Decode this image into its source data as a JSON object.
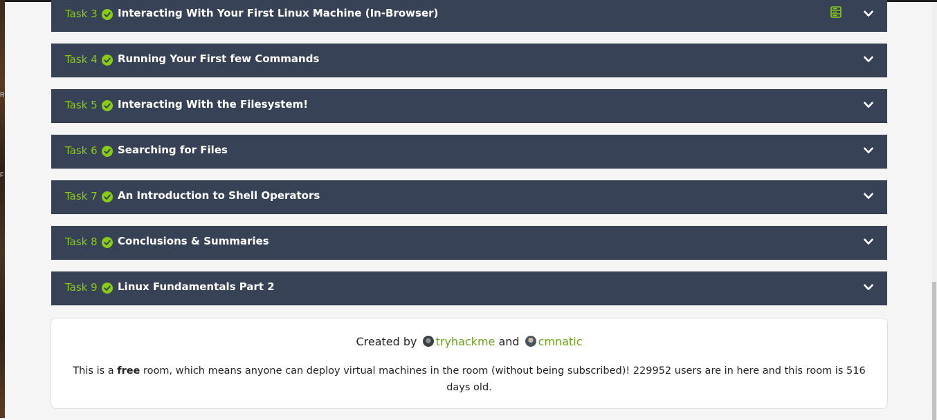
{
  "tasks": [
    {
      "label": "Task 3",
      "title": "Interacting With Your First Linux Machine (In-Browser)",
      "has_vm_icon": true
    },
    {
      "label": "Task 4",
      "title": "Running Your First few Commands",
      "has_vm_icon": false
    },
    {
      "label": "Task 5",
      "title": "Interacting With the Filesystem!",
      "has_vm_icon": false
    },
    {
      "label": "Task 6",
      "title": "Searching for Files",
      "has_vm_icon": false
    },
    {
      "label": "Task 7",
      "title": "An Introduction to Shell Operators",
      "has_vm_icon": false
    },
    {
      "label": "Task 8",
      "title": "Conclusions & Summaries",
      "has_vm_icon": false
    },
    {
      "label": "Task 9",
      "title": "Linux Fundamentals Part 2",
      "has_vm_icon": false
    }
  ],
  "task_status_icon": "check-circle-icon",
  "expand_icon": "chevron-down-icon",
  "credits": {
    "created_by": "Created by",
    "author1": "tryhackme",
    "and": "and",
    "author2": "cmnatic",
    "desc_pre": "This is a",
    "desc_free": "free",
    "desc_post": "room, which means anyone can deploy virtual machines in the room (without being subscribed)! 229952 users are in here and this room is 516 days old."
  },
  "colors": {
    "task_bg": "#384256",
    "task_number": "#88cc14",
    "check": "#88cc14",
    "author_link": "#6aa417",
    "page_bg": "#f5f5f6"
  }
}
